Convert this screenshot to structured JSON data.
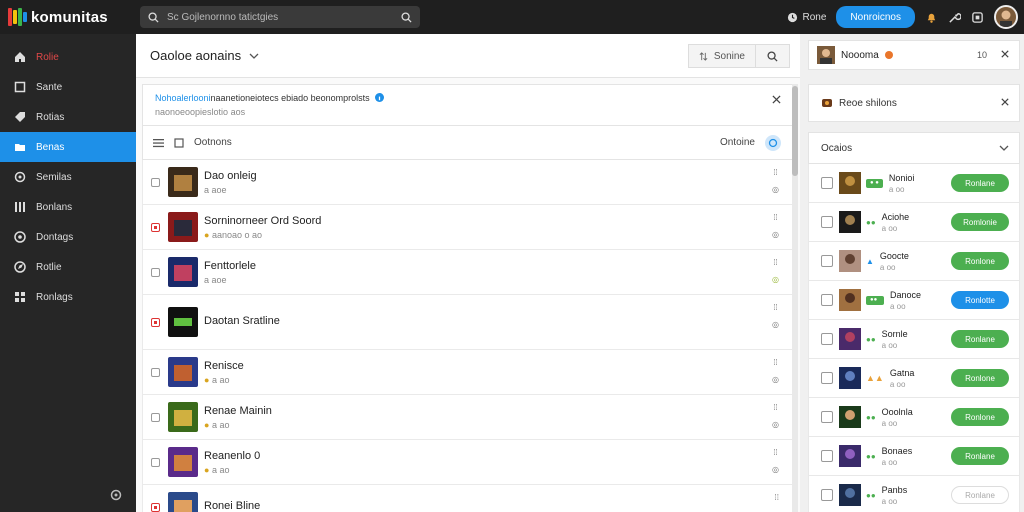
{
  "app": {
    "name": "komunitas"
  },
  "topbar": {
    "search_placeholder": "Sc Gojlenornno tatictgies",
    "link_label": "Rone",
    "primary_button": "Nonroicnos"
  },
  "sidebar": {
    "items": [
      {
        "label": "Rolie",
        "icon": "home-icon",
        "active": false,
        "red": true
      },
      {
        "label": "Sante",
        "icon": "square-icon",
        "active": false
      },
      {
        "label": "Rotias",
        "icon": "tag-icon",
        "active": false
      },
      {
        "label": "Benas",
        "icon": "folder-icon",
        "active": true
      },
      {
        "label": "Semilas",
        "icon": "gamepad-icon",
        "active": false
      },
      {
        "label": "Bonlans",
        "icon": "library-icon",
        "active": false
      },
      {
        "label": "Dontags",
        "icon": "disc-icon",
        "active": false
      },
      {
        "label": "Rotlie",
        "icon": "compass-icon",
        "active": false
      },
      {
        "label": "Ronlags",
        "icon": "grid-icon",
        "active": false
      }
    ]
  },
  "main": {
    "title": "Oaoloe aonains",
    "sort_label": "Sonine",
    "notice": {
      "line1_link": "Nohoalerlooni",
      "line1_rest": "naanetioneiotecs ebiado beonomprolsts",
      "line2": "naonoeoopieslotio aos"
    },
    "list_header": {
      "label": "Ootnons",
      "option": "Ontoine"
    },
    "rows": [
      {
        "name": "Dao onleig",
        "meta": "a aoe",
        "flag": false,
        "c1": "#3a2a1a",
        "c2": "#b08040"
      },
      {
        "name": "Sorninorneer Ord Soord",
        "meta": "aanoao o ao",
        "flag": true,
        "c1": "#8a1a1a",
        "c2": "#2a2a3a"
      },
      {
        "name": "Fenttorlele",
        "meta": "a aoe",
        "flag": false,
        "c1": "#1a2a6a",
        "c2": "#c04060"
      },
      {
        "name": "Daotan Sratline",
        "meta": "",
        "flag": true,
        "c1": "#101010",
        "c2": "#60c040"
      },
      {
        "name": "Renisce",
        "meta": "a ao",
        "flag": false,
        "c1": "#2a3a8a",
        "c2": "#c06030"
      },
      {
        "name": "Renae Mainin",
        "meta": "a ao",
        "flag": false,
        "c1": "#3a6a1a",
        "c2": "#d0b040"
      },
      {
        "name": "Reanenlo 0",
        "meta": "a ao",
        "flag": false,
        "c1": "#5a2a8a",
        "c2": "#d08040"
      },
      {
        "name": "Ronei Bline",
        "meta": "",
        "flag": true,
        "c1": "#2a4a8a",
        "c2": "#e0a060"
      }
    ]
  },
  "right": {
    "profile_name": "Noooma",
    "profile_count": "10",
    "request_title": "Reoe shilons",
    "group_title": "Ocaios",
    "friends": [
      {
        "name": "Nonioi",
        "meta": "a oo",
        "button": "Ronlane",
        "btn": "green",
        "c1": "#6a4a1a",
        "c2": "#c09040"
      },
      {
        "name": "Aciohe",
        "meta": "a oo",
        "button": "Romlonie",
        "btn": "green",
        "c1": "#1a1a1a",
        "c2": "#a08050"
      },
      {
        "name": "Goocte",
        "meta": "a oo",
        "button": "Ronlone",
        "btn": "green",
        "c1": "#b09080",
        "c2": "#604030"
      },
      {
        "name": "Danoce",
        "meta": "a oo",
        "button": "Ronlotte",
        "btn": "blue",
        "c1": "#a07040",
        "c2": "#503020"
      },
      {
        "name": "Sornle",
        "meta": "a oo",
        "button": "Ronlane",
        "btn": "green",
        "c1": "#4a2a6a",
        "c2": "#b04060"
      },
      {
        "name": "Gatna",
        "meta": "a oo",
        "button": "Ronlone",
        "btn": "green",
        "c1": "#1a2a5a",
        "c2": "#6080c0"
      },
      {
        "name": "Ooolnla",
        "meta": "a oo",
        "button": "Ronlone",
        "btn": "green",
        "c1": "#1a3a1a",
        "c2": "#d0a070"
      },
      {
        "name": "Bonaes",
        "meta": "a oo",
        "button": "Ronlane",
        "btn": "green",
        "c1": "#3a2a6a",
        "c2": "#9060c0"
      },
      {
        "name": "Panbs",
        "meta": "a oo",
        "button": "Ronlane",
        "btn": "ghost",
        "c1": "#1a2a4a",
        "c2": "#5070a0"
      }
    ]
  },
  "colors": {
    "accent": "#1e90e8",
    "success": "#4caf50",
    "sidebar": "#262626",
    "topbar": "#1f1f1f"
  }
}
